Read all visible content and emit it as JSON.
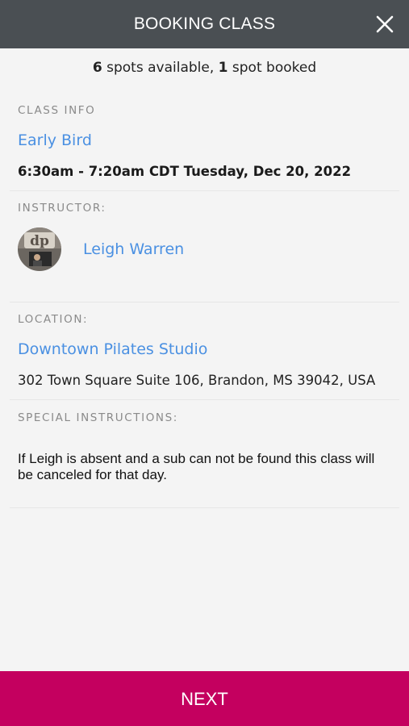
{
  "header": {
    "title": "BOOKING CLASS",
    "close_icon": "close-icon"
  },
  "availability": {
    "spots_available": "6",
    "spots_available_text": " spots available, ",
    "spots_booked": "1",
    "spots_booked_text": " spot booked"
  },
  "class_info": {
    "label": "CLASS INFO",
    "name": "Early Bird",
    "time": "6:30am - 7:20am CDT Tuesday, Dec 20, 2022"
  },
  "instructor": {
    "label": "INSTRUCTOR:",
    "name": "Leigh Warren",
    "avatar_icon": "avatar"
  },
  "location": {
    "label": "LOCATION:",
    "name": "Downtown Pilates Studio",
    "address": "302 Town Square Suite 106, Brandon, MS 39042, USA"
  },
  "special_instructions": {
    "label": "SPECIAL INSTRUCTIONS:",
    "text": "If Leigh is absent and a sub can not be found this class will be canceled for that day."
  },
  "footer": {
    "next_label": "NEXT"
  },
  "colors": {
    "header_bg": "#4a4f53",
    "link": "#4a90e2",
    "next_bg": "#c4005f",
    "page_bg": "#f4f4f4"
  }
}
